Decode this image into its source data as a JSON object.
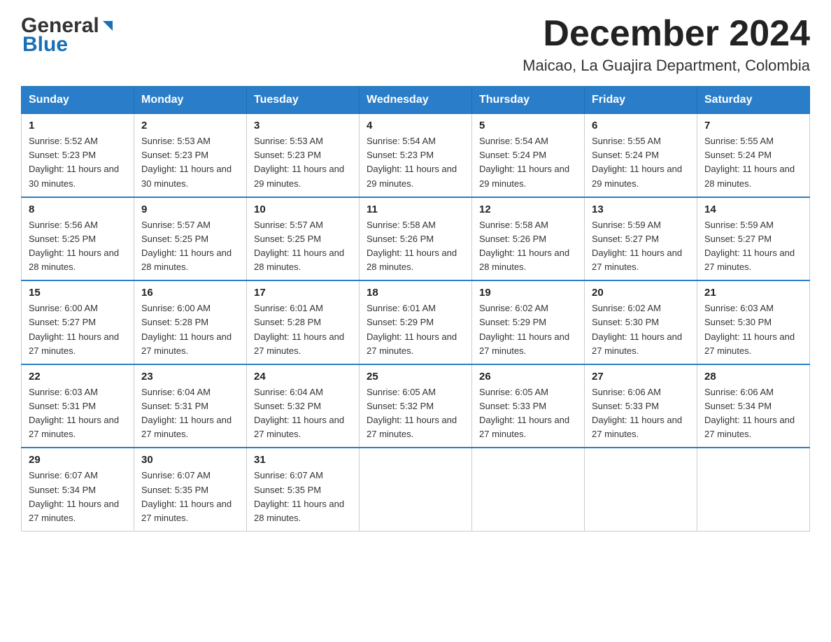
{
  "header": {
    "logo_general": "General",
    "logo_blue": "Blue",
    "month_title": "December 2024",
    "location": "Maicao, La Guajira Department, Colombia"
  },
  "weekdays": [
    "Sunday",
    "Monday",
    "Tuesday",
    "Wednesday",
    "Thursday",
    "Friday",
    "Saturday"
  ],
  "weeks": [
    [
      {
        "day": "1",
        "sunrise": "5:52 AM",
        "sunset": "5:23 PM",
        "daylight": "11 hours and 30 minutes."
      },
      {
        "day": "2",
        "sunrise": "5:53 AM",
        "sunset": "5:23 PM",
        "daylight": "11 hours and 30 minutes."
      },
      {
        "day": "3",
        "sunrise": "5:53 AM",
        "sunset": "5:23 PM",
        "daylight": "11 hours and 29 minutes."
      },
      {
        "day": "4",
        "sunrise": "5:54 AM",
        "sunset": "5:23 PM",
        "daylight": "11 hours and 29 minutes."
      },
      {
        "day": "5",
        "sunrise": "5:54 AM",
        "sunset": "5:24 PM",
        "daylight": "11 hours and 29 minutes."
      },
      {
        "day": "6",
        "sunrise": "5:55 AM",
        "sunset": "5:24 PM",
        "daylight": "11 hours and 29 minutes."
      },
      {
        "day": "7",
        "sunrise": "5:55 AM",
        "sunset": "5:24 PM",
        "daylight": "11 hours and 28 minutes."
      }
    ],
    [
      {
        "day": "8",
        "sunrise": "5:56 AM",
        "sunset": "5:25 PM",
        "daylight": "11 hours and 28 minutes."
      },
      {
        "day": "9",
        "sunrise": "5:57 AM",
        "sunset": "5:25 PM",
        "daylight": "11 hours and 28 minutes."
      },
      {
        "day": "10",
        "sunrise": "5:57 AM",
        "sunset": "5:25 PM",
        "daylight": "11 hours and 28 minutes."
      },
      {
        "day": "11",
        "sunrise": "5:58 AM",
        "sunset": "5:26 PM",
        "daylight": "11 hours and 28 minutes."
      },
      {
        "day": "12",
        "sunrise": "5:58 AM",
        "sunset": "5:26 PM",
        "daylight": "11 hours and 28 minutes."
      },
      {
        "day": "13",
        "sunrise": "5:59 AM",
        "sunset": "5:27 PM",
        "daylight": "11 hours and 27 minutes."
      },
      {
        "day": "14",
        "sunrise": "5:59 AM",
        "sunset": "5:27 PM",
        "daylight": "11 hours and 27 minutes."
      }
    ],
    [
      {
        "day": "15",
        "sunrise": "6:00 AM",
        "sunset": "5:27 PM",
        "daylight": "11 hours and 27 minutes."
      },
      {
        "day": "16",
        "sunrise": "6:00 AM",
        "sunset": "5:28 PM",
        "daylight": "11 hours and 27 minutes."
      },
      {
        "day": "17",
        "sunrise": "6:01 AM",
        "sunset": "5:28 PM",
        "daylight": "11 hours and 27 minutes."
      },
      {
        "day": "18",
        "sunrise": "6:01 AM",
        "sunset": "5:29 PM",
        "daylight": "11 hours and 27 minutes."
      },
      {
        "day": "19",
        "sunrise": "6:02 AM",
        "sunset": "5:29 PM",
        "daylight": "11 hours and 27 minutes."
      },
      {
        "day": "20",
        "sunrise": "6:02 AM",
        "sunset": "5:30 PM",
        "daylight": "11 hours and 27 minutes."
      },
      {
        "day": "21",
        "sunrise": "6:03 AM",
        "sunset": "5:30 PM",
        "daylight": "11 hours and 27 minutes."
      }
    ],
    [
      {
        "day": "22",
        "sunrise": "6:03 AM",
        "sunset": "5:31 PM",
        "daylight": "11 hours and 27 minutes."
      },
      {
        "day": "23",
        "sunrise": "6:04 AM",
        "sunset": "5:31 PM",
        "daylight": "11 hours and 27 minutes."
      },
      {
        "day": "24",
        "sunrise": "6:04 AM",
        "sunset": "5:32 PM",
        "daylight": "11 hours and 27 minutes."
      },
      {
        "day": "25",
        "sunrise": "6:05 AM",
        "sunset": "5:32 PM",
        "daylight": "11 hours and 27 minutes."
      },
      {
        "day": "26",
        "sunrise": "6:05 AM",
        "sunset": "5:33 PM",
        "daylight": "11 hours and 27 minutes."
      },
      {
        "day": "27",
        "sunrise": "6:06 AM",
        "sunset": "5:33 PM",
        "daylight": "11 hours and 27 minutes."
      },
      {
        "day": "28",
        "sunrise": "6:06 AM",
        "sunset": "5:34 PM",
        "daylight": "11 hours and 27 minutes."
      }
    ],
    [
      {
        "day": "29",
        "sunrise": "6:07 AM",
        "sunset": "5:34 PM",
        "daylight": "11 hours and 27 minutes."
      },
      {
        "day": "30",
        "sunrise": "6:07 AM",
        "sunset": "5:35 PM",
        "daylight": "11 hours and 27 minutes."
      },
      {
        "day": "31",
        "sunrise": "6:07 AM",
        "sunset": "5:35 PM",
        "daylight": "11 hours and 28 minutes."
      },
      null,
      null,
      null,
      null
    ]
  ]
}
